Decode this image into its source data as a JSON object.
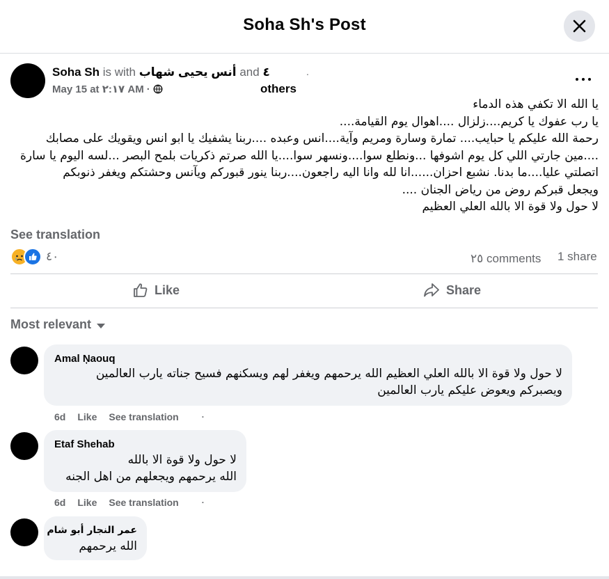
{
  "header": {
    "title": "Soha Sh's Post",
    "close_label": "Close"
  },
  "post": {
    "author": "Soha Sh",
    "with_text": "is with",
    "tagged": "أنس يحيى شهاب",
    "and_text": "and",
    "others_count": "٤",
    "others_label": "others",
    "dot": ".",
    "date": "May 15 at ٢:١٧ AM",
    "separator": "·",
    "audience_icon": "globe-icon",
    "lines": [
      "يا الله الا تكفي هذه الدماء",
      "يا رب عفوك يا كريم....زلزال ....اهوال يوم القيامة....",
      "رحمة الله عليكم يا حبايب.... تمارة وسارة ومريم وآية....انس وعبده ....ربنا يشفيك يا ابو انس ويقويك على مصابك",
      "....مين جارتي اللي كل يوم اشوفها ...ونطلع سوا....ونسهر سوا....يا الله صرتم ذكريات بلمح البصر ...لسه اليوم يا سارة",
      "اتصلتي عليا....ما بدنا. نشبع احزان......انا لله وانا اليه راجعون....ربنا ينور قبوركم ويآنس وحشتكم  ويغفر ذنوبكم",
      "ويجعل قبركم روض من رياض الجنان ....",
      "لا حول ولا قوة الا بالله العلي العظيم"
    ],
    "see_translation": "See translation",
    "reaction_count": "٤٠",
    "comments_count": "٢٥ comments",
    "shares_count": "1 share"
  },
  "actions": {
    "like": "Like",
    "share": "Share"
  },
  "filter": {
    "label": "Most relevant"
  },
  "comments": [
    {
      "name": "Amal Ņaouq",
      "lines": [
        "لا حول ولا قوة الا بالله العلي العظيم الله يرحمهم ويغفر لهم ويسكنهم فسيح جناته يارب العالمين",
        "ويصبركم ويعوض عليكم يارب العالمين"
      ],
      "time": "6d",
      "like": "Like",
      "see_translation": "See translation",
      "sep": "·"
    },
    {
      "name": "Etaf Shehab",
      "lines": [
        "لا حول ولا قوة الا بالله",
        "الله يرحمهم ويجعلهم من اهل الجنه"
      ],
      "time": "6d",
      "like": "Like",
      "see_translation": "See translation",
      "sep": "·"
    },
    {
      "name": "عمر النجار أبو شام",
      "lines": [
        "الله يرحمهم"
      ]
    }
  ],
  "colors": {
    "muted": "#65676b",
    "bubble": "#f0f2f5",
    "like_blue": "#1b74e4",
    "sad_yellow": "#f7b125"
  }
}
